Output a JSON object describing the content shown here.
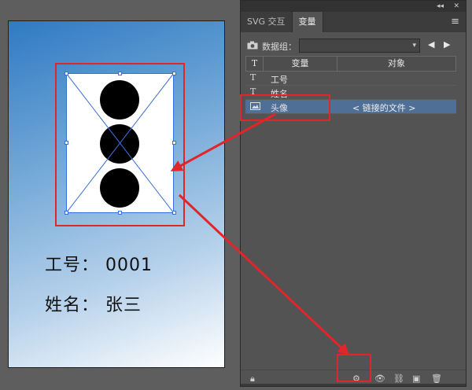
{
  "artboard": {
    "employee_id_line": "工号： 0001",
    "name_line": "姓名： 张三"
  },
  "panel": {
    "tabs": [
      {
        "label": "SVG 交互",
        "active": false
      },
      {
        "label": "变量",
        "active": true
      }
    ],
    "collapse_icon": "double-chevron-icon",
    "close_icon": "close-icon",
    "menu_icon": "hamburger-icon",
    "dataset": {
      "label": "数据组：",
      "value": ""
    },
    "table": {
      "headers": {
        "type_icon": "T",
        "variable": "变量",
        "object": "对象"
      },
      "rows": [
        {
          "icon": "T",
          "name": "工号",
          "object": "",
          "selected": false
        },
        {
          "icon": "T",
          "name": "姓名",
          "object": "",
          "selected": false
        },
        {
          "icon": "image-icon",
          "name": "头像",
          "object": "< 链接的文件 >",
          "selected": true
        }
      ]
    },
    "bottom_icons": [
      "lock-icon",
      "capture-icon",
      "make-visible-icon",
      "unbind-icon",
      "new-variable-icon",
      "delete-icon"
    ]
  },
  "colors": {
    "annotation": "#e0252b",
    "selection": "#3a6fd8",
    "selected_row": "#4f6f96"
  }
}
